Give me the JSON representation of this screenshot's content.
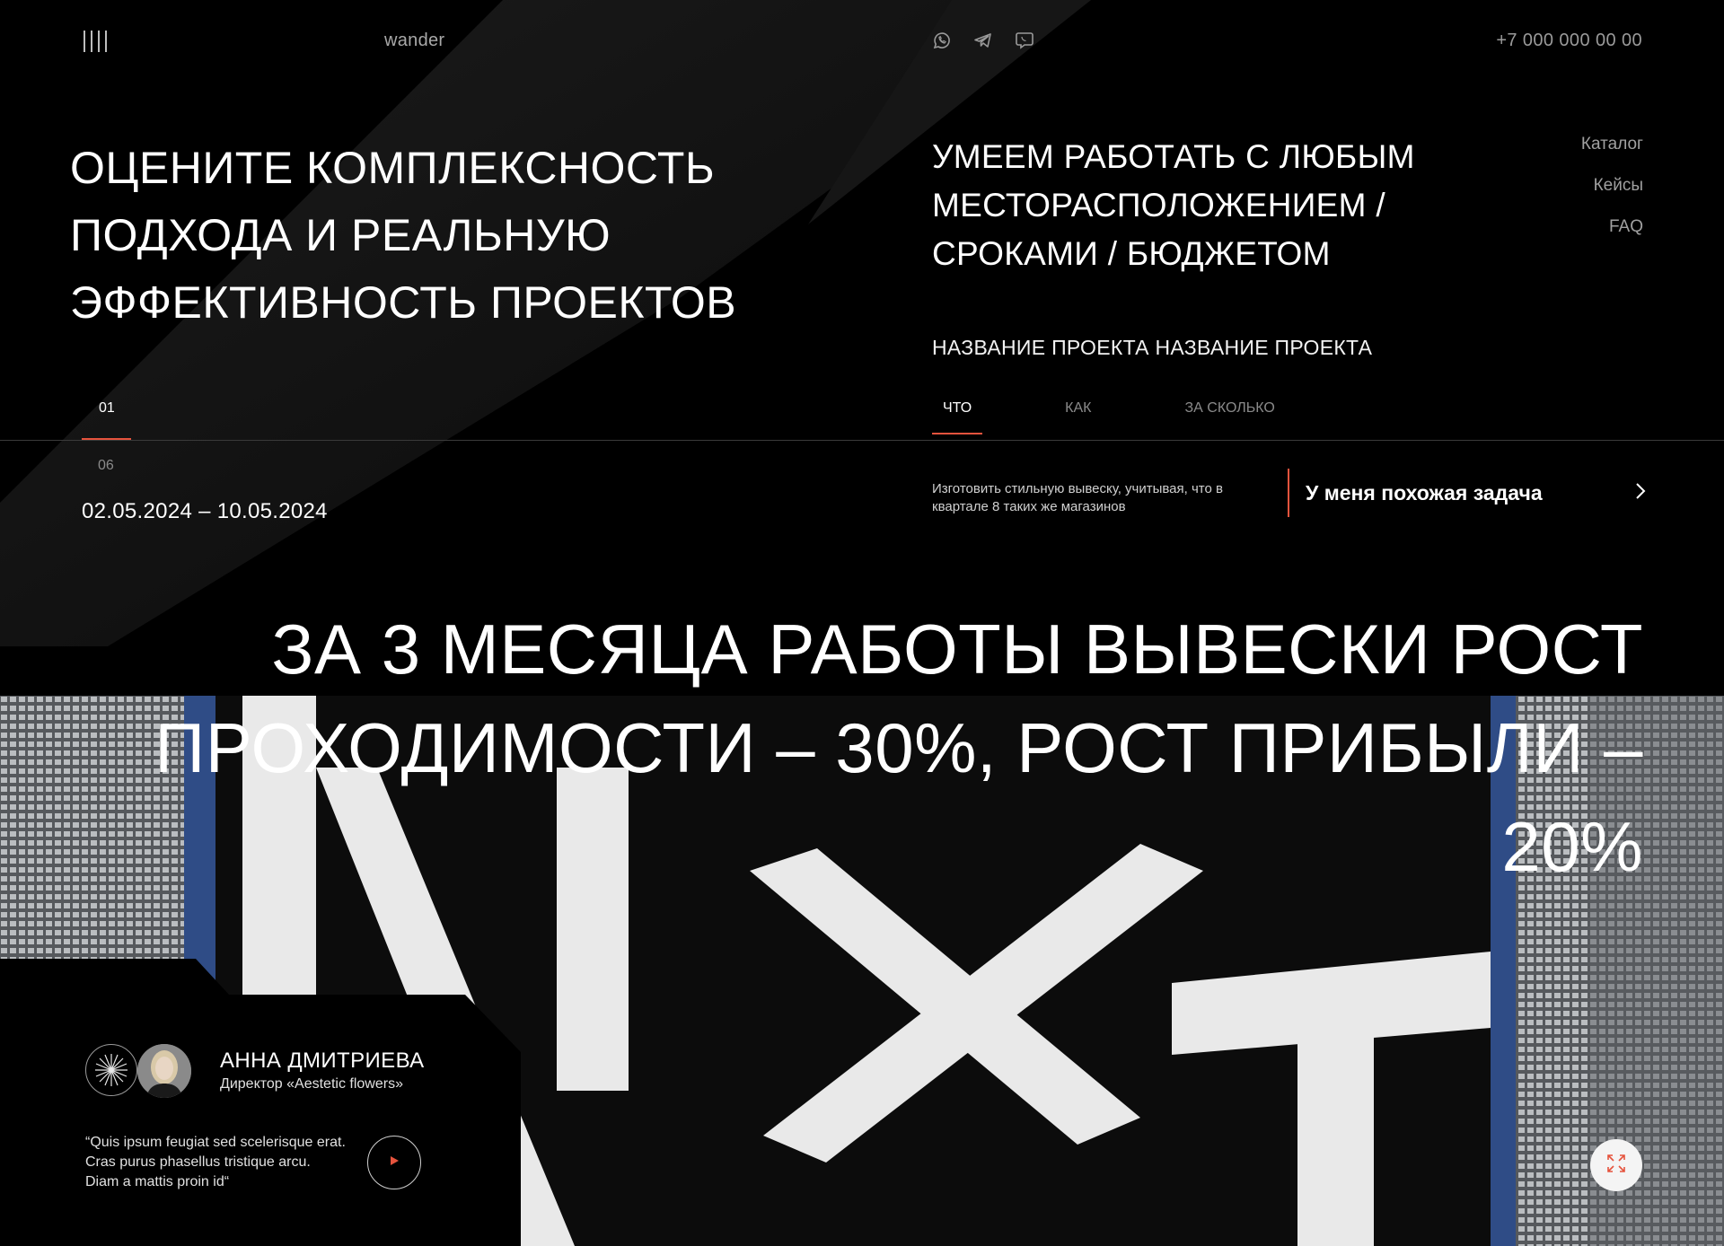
{
  "header": {
    "logo": "wander",
    "phone": "+7 000 000 00 00",
    "socials": [
      "whatsapp-icon",
      "telegram-icon",
      "viber-icon"
    ]
  },
  "hero": {
    "headline": "Оцените комплексность подхода и реальную эффективность проектов",
    "subhead": "Умеем работать с любым месторасположением / сроками / бюджетом",
    "project_name": "Название проекта название проекта"
  },
  "nav": {
    "items": [
      {
        "label": "Каталог"
      },
      {
        "label": "Кейсы"
      },
      {
        "label": "FAQ"
      }
    ]
  },
  "tabs": [
    {
      "label": "Что",
      "active": true
    },
    {
      "label": "Как",
      "active": false
    },
    {
      "label": "За сколько",
      "active": false
    }
  ],
  "pagination": {
    "current": "01",
    "total": "06"
  },
  "dates": "02.05.2024 – 10.05.2024",
  "task": {
    "text": "Изготовить стильную вывеску, учитывая, что в квартале 8 таких же магазинов",
    "cta_label": "У меня похожая задача"
  },
  "result": {
    "line1": "За 3 месяца работы вывески рост",
    "line2": "проходимости – 30%, рост прибыли – 20%"
  },
  "testimonial": {
    "name": "Анна Дмитриева",
    "role": "Директор «Aestetic flowers»",
    "quote": "“Quis ipsum feugiat sed scelerisque erat. Cras purus phasellus tristique arcu. Diam a mattis proin id“"
  },
  "colors": {
    "accent": "#e5533d",
    "background": "#000000",
    "text": "#ffffff",
    "muted": "#8a8a8a"
  }
}
